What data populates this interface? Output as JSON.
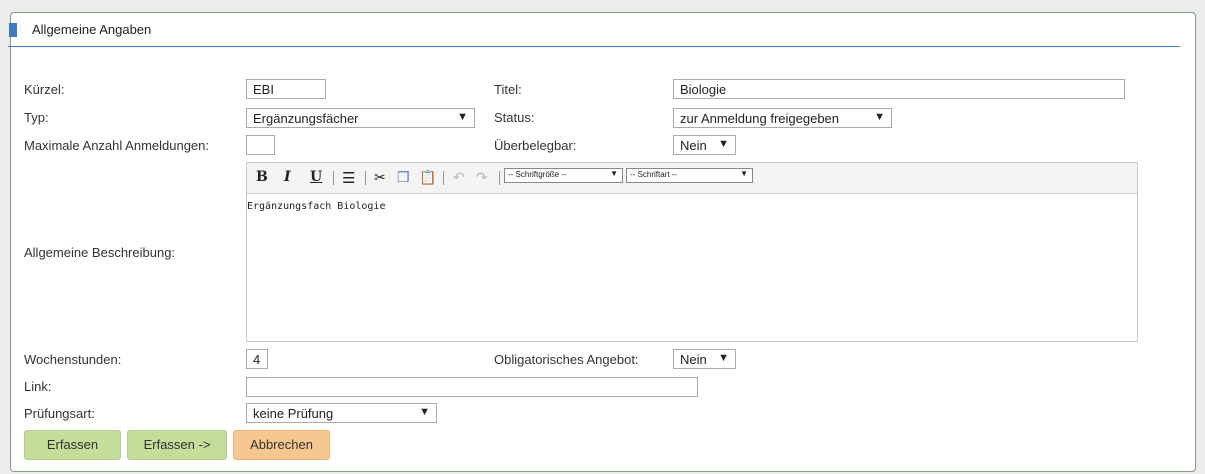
{
  "section": {
    "title": "Allgemeine Angaben"
  },
  "fields": {
    "kuerzel": {
      "label": "Kürzel:",
      "value": "EBI"
    },
    "titel": {
      "label": "Titel:",
      "value": "Biologie"
    },
    "typ": {
      "label": "Typ:",
      "value": "Ergänzungsfächer"
    },
    "status": {
      "label": "Status:",
      "value": "zur Anmeldung freigegeben"
    },
    "max_anmeldungen": {
      "label": "Maximale Anzahl Anmeldungen:",
      "value": ""
    },
    "ueberbelegbar": {
      "label": "Überbelegbar:",
      "value": "Nein"
    },
    "beschreibung": {
      "label": "Allgemeine Beschreibung:",
      "value": "Ergänzungsfach Biologie"
    },
    "wochenstunden": {
      "label": "Wochenstunden:",
      "value": "4"
    },
    "obligatorisch": {
      "label": "Obligatorisches Angebot:",
      "value": "Nein"
    },
    "link": {
      "label": "Link:",
      "value": ""
    },
    "pruefungsart": {
      "label": "Prüfungsart:",
      "value": "keine Prüfung"
    }
  },
  "editor_toolbar": {
    "bold": "B",
    "italic": "I",
    "underline": "U",
    "fontsize_select": "-- Schriftgröße --",
    "font_select": "-- Schriftart --"
  },
  "buttons": {
    "erfassen": "Erfassen",
    "erfassen_next": "Erfassen ->",
    "abbrechen": "Abbrechen"
  },
  "colors": {
    "accent": "#3d7cc4",
    "button_green": "#c5dd9a",
    "button_orange": "#f6c78f"
  }
}
